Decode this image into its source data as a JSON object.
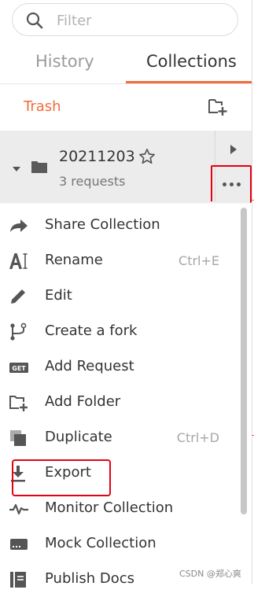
{
  "search": {
    "placeholder": "Filter",
    "icon": "search-icon"
  },
  "tabs": [
    {
      "label": "History",
      "active": false
    },
    {
      "label": "Collections",
      "active": true
    }
  ],
  "trash": {
    "label": "Trash",
    "new_collection_icon": "new-collection-icon"
  },
  "collection": {
    "name": "20211203",
    "count": "3 requests",
    "icons": [
      "caret-down-icon",
      "folder-icon",
      "star-icon",
      "chevron-right-icon",
      "more-icon"
    ]
  },
  "menu": {
    "items": [
      {
        "label": "Share Collection",
        "shortcut": "",
        "icon": "share-icon"
      },
      {
        "label": "Rename",
        "shortcut": "Ctrl+E",
        "icon": "rename-icon"
      },
      {
        "label": "Edit",
        "shortcut": "",
        "icon": "pencil-icon"
      },
      {
        "label": "Create a fork",
        "shortcut": "",
        "icon": "fork-icon"
      },
      {
        "label": "Add Request",
        "shortcut": "",
        "icon": "get-request-icon"
      },
      {
        "label": "Add Folder",
        "shortcut": "",
        "icon": "add-folder-icon"
      },
      {
        "label": "Duplicate",
        "shortcut": "Ctrl+D",
        "icon": "duplicate-icon"
      },
      {
        "label": "Export",
        "shortcut": "",
        "icon": "export-icon"
      },
      {
        "label": "Monitor Collection",
        "shortcut": "",
        "icon": "monitor-icon"
      },
      {
        "label": "Mock Collection",
        "shortcut": "",
        "icon": "mock-server-icon"
      },
      {
        "label": "Publish Docs",
        "shortcut": "",
        "icon": "docs-icon"
      }
    ]
  },
  "colors": {
    "accent": "#f26b3a",
    "highlight_box": "#e60012",
    "row_bg": "#ececec"
  },
  "watermark": "CSDN @郑心爽"
}
